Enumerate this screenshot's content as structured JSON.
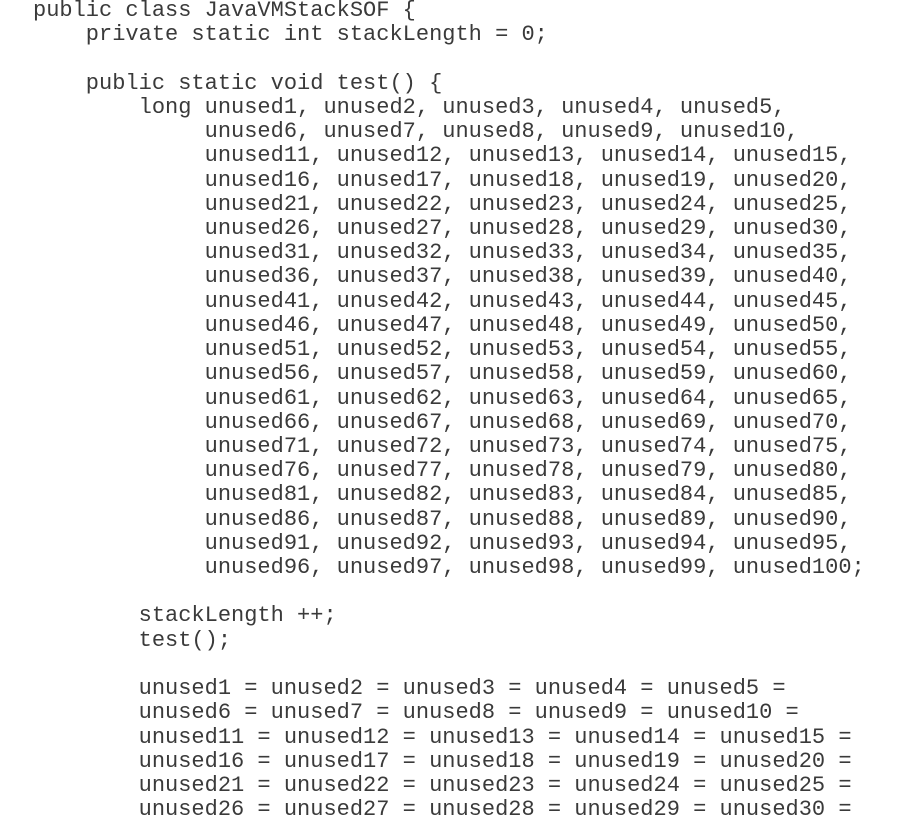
{
  "code": {
    "lines": [
      "public class JavaVMStackSOF {",
      "    private static int stackLength = 0;",
      "",
      "    public static void test() {",
      "        long unused1, unused2, unused3, unused4, unused5,",
      "             unused6, unused7, unused8, unused9, unused10,",
      "             unused11, unused12, unused13, unused14, unused15,",
      "             unused16, unused17, unused18, unused19, unused20,",
      "             unused21, unused22, unused23, unused24, unused25,",
      "             unused26, unused27, unused28, unused29, unused30,",
      "             unused31, unused32, unused33, unused34, unused35,",
      "             unused36, unused37, unused38, unused39, unused40,",
      "             unused41, unused42, unused43, unused44, unused45,",
      "             unused46, unused47, unused48, unused49, unused50,",
      "             unused51, unused52, unused53, unused54, unused55,",
      "             unused56, unused57, unused58, unused59, unused60,",
      "             unused61, unused62, unused63, unused64, unused65,",
      "             unused66, unused67, unused68, unused69, unused70,",
      "             unused71, unused72, unused73, unused74, unused75,",
      "             unused76, unused77, unused78, unused79, unused80,",
      "             unused81, unused82, unused83, unused84, unused85,",
      "             unused86, unused87, unused88, unused89, unused90,",
      "             unused91, unused92, unused93, unused94, unused95,",
      "             unused96, unused97, unused98, unused99, unused100;",
      "",
      "        stackLength ++;",
      "        test();",
      "",
      "        unused1 = unused2 = unused3 = unused4 = unused5 =",
      "        unused6 = unused7 = unused8 = unused9 = unused10 =",
      "        unused11 = unused12 = unused13 = unused14 = unused15 =",
      "        unused16 = unused17 = unused18 = unused19 = unused20 =",
      "        unused21 = unused22 = unused23 = unused24 = unused25 =",
      "        unused26 = unused27 = unused28 = unused29 = unused30 ="
    ]
  }
}
